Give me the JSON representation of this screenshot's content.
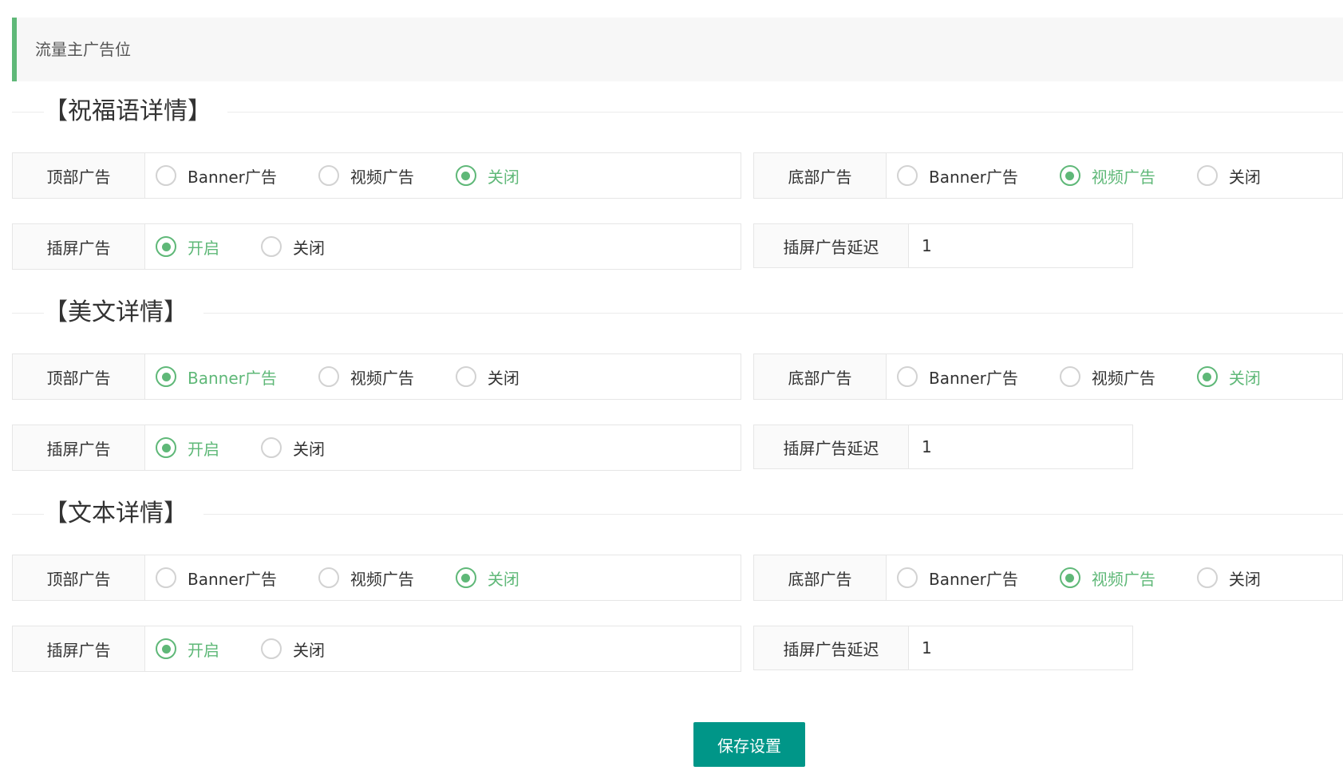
{
  "page": {
    "title": "流量主广告位"
  },
  "colors": {
    "accent": "#5fb878",
    "button": "#009688"
  },
  "sections": [
    {
      "title": "【祝福语详情】",
      "top_ad": {
        "label": "顶部广告",
        "options": [
          "Banner广告",
          "视频广告",
          "关闭"
        ],
        "selected": "关闭"
      },
      "bottom_ad": {
        "label": "底部广告",
        "options": [
          "Banner广告",
          "视频广告",
          "关闭"
        ],
        "selected": "视频广告"
      },
      "interstitial": {
        "label": "插屏广告",
        "options": [
          "开启",
          "关闭"
        ],
        "selected": "开启"
      },
      "delay": {
        "label": "插屏广告延迟",
        "value": "1"
      }
    },
    {
      "title": "【美文详情】",
      "top_ad": {
        "label": "顶部广告",
        "options": [
          "Banner广告",
          "视频广告",
          "关闭"
        ],
        "selected": "Banner广告"
      },
      "bottom_ad": {
        "label": "底部广告",
        "options": [
          "Banner广告",
          "视频广告",
          "关闭"
        ],
        "selected": "关闭"
      },
      "interstitial": {
        "label": "插屏广告",
        "options": [
          "开启",
          "关闭"
        ],
        "selected": "开启"
      },
      "delay": {
        "label": "插屏广告延迟",
        "value": "1"
      }
    },
    {
      "title": "【文本详情】",
      "top_ad": {
        "label": "顶部广告",
        "options": [
          "Banner广告",
          "视频广告",
          "关闭"
        ],
        "selected": "关闭"
      },
      "bottom_ad": {
        "label": "底部广告",
        "options": [
          "Banner广告",
          "视频广告",
          "关闭"
        ],
        "selected": "视频广告"
      },
      "interstitial": {
        "label": "插屏广告",
        "options": [
          "开启",
          "关闭"
        ],
        "selected": "开启"
      },
      "delay": {
        "label": "插屏广告延迟",
        "value": "1"
      }
    }
  ],
  "actions": {
    "save_label": "保存设置"
  }
}
